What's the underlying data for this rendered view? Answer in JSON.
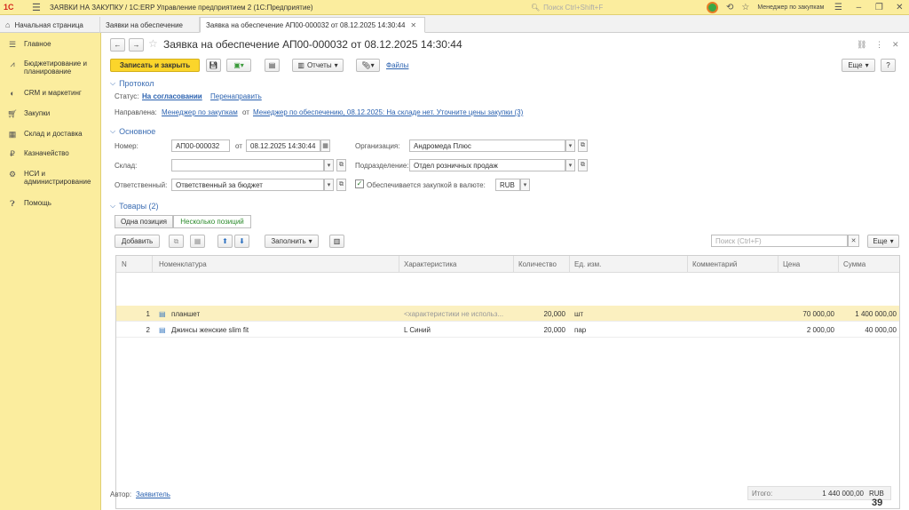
{
  "titlebar": {
    "logo": "1С",
    "title": "ЗАЯВКИ НА ЗАКУПКУ / 1С:ERP Управление предприятием 2  (1С:Предприятие)",
    "search_placeholder": "Поиск Ctrl+Shift+F",
    "user": "Менеджер по закупкам"
  },
  "tabs": [
    {
      "label": "Начальная страница"
    },
    {
      "label": "Заявки на обеспечение"
    },
    {
      "label": "Заявка на обеспечение АП00-000032 от 08.12.2025 14:30:44"
    }
  ],
  "sidebar": {
    "items": [
      {
        "label": "Главное",
        "icon": "menu-icon"
      },
      {
        "label": "Бюджетирование и планирование",
        "icon": "chart-icon"
      },
      {
        "label": "CRM и маркетинг",
        "icon": "crm-icon"
      },
      {
        "label": "Закупки",
        "icon": "cart-icon"
      },
      {
        "label": "Склад и доставка",
        "icon": "warehouse-icon"
      },
      {
        "label": "Казначейство",
        "icon": "treasury-icon"
      },
      {
        "label": "НСИ и администрирование",
        "icon": "gear-icon"
      },
      {
        "label": "Помощь",
        "icon": "help-icon"
      }
    ]
  },
  "doc": {
    "title": "Заявка на обеспечение АП00-000032 от 08.12.2025 14:30:44",
    "toolbar": {
      "save_close": "Записать и закрыть",
      "reports": "Отчеты",
      "files": "Файлы",
      "more": "Еще",
      "help": "?"
    },
    "protocol": {
      "header": "Протокол",
      "status_label": "Статус:",
      "status_value": "На согласовании",
      "redirect": "Перенаправить",
      "sent_label": "Направлена:",
      "sent_from": "Менеджер по закупкам",
      "sent_from_sep": "от",
      "sent_detail": "Менеджер по обеспечению, 08.12.2025: На складе нет. Уточните цены закупки (3)"
    },
    "main": {
      "header": "Основное",
      "number_label": "Номер:",
      "number": "АП00-000032",
      "date_label": "от",
      "date": "08.12.2025 14:30:44",
      "org_label": "Организация:",
      "org": "Андромеда Плюс",
      "warehouse_label": "Склад:",
      "warehouse": "",
      "division_label": "Подразделение:",
      "division": "Отдел розничных продаж",
      "responsible_label": "Ответственный:",
      "responsible": "Ответственный за бюджет",
      "currency_check_label": "Обеспечивается закупкой в валюте:",
      "currency": "RUB"
    },
    "goods": {
      "header": "Товары (2)",
      "mode_one": "Одна позиция",
      "mode_many": "Несколько позиций",
      "add": "Добавить",
      "fill": "Заполнить",
      "search_placeholder": "Поиск (Ctrl+F)",
      "more": "Еще",
      "columns": [
        "N",
        "Номенклатура",
        "Характеристика",
        "Количество",
        "Ед. изм.",
        "Комментарий",
        "Цена",
        "Сумма"
      ],
      "rows": [
        {
          "n": "1",
          "item": "планшет",
          "characteristic": "<характеристики не использ...",
          "qty": "20,000",
          "unit": "шт",
          "comment": "",
          "price": "70 000,00",
          "sum": "1 400 000,00"
        },
        {
          "n": "2",
          "item": "Джинсы женские slim fit",
          "characteristic": "L Синий",
          "qty": "20,000",
          "unit": "пар",
          "comment": "",
          "price": "2 000,00",
          "sum": "40 000,00"
        }
      ]
    },
    "footer": {
      "author_label": "Автор:",
      "author": "Заявитель",
      "total_label": "Итого:",
      "total": "1 440 000,00",
      "currency": "RUB"
    }
  },
  "page_number": "39"
}
